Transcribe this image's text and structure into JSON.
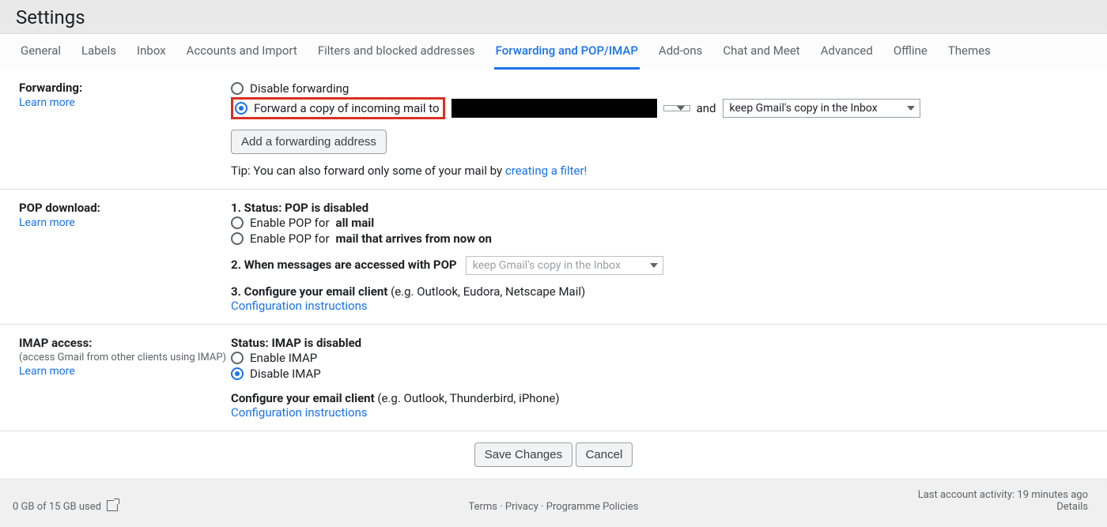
{
  "title": "Settings",
  "tabs": [
    "General",
    "Labels",
    "Inbox",
    "Accounts and Import",
    "Filters and blocked addresses",
    "Forwarding and POP/IMAP",
    "Add-ons",
    "Chat and Meet",
    "Advanced",
    "Offline",
    "Themes"
  ],
  "active_tab_index": 5,
  "forwarding": {
    "heading": "Forwarding:",
    "learn_more": "Learn more",
    "option_disable": "Disable forwarding",
    "option_forward_prefix": "Forward a copy of incoming mail to",
    "and_word": "and",
    "action_select": "keep Gmail's copy in the Inbox",
    "add_address_btn": "Add a forwarding address",
    "tip_prefix": "Tip: You can also forward only some of your mail by ",
    "tip_link": "creating a filter!"
  },
  "pop": {
    "heading": "POP download:",
    "learn_more": "Learn more",
    "status_label": "1. Status: ",
    "status_value": "POP is disabled",
    "enable_all_prefix": "Enable POP for ",
    "enable_all_bold": "all mail",
    "enable_new_prefix": "Enable POP for ",
    "enable_new_bold": "mail that arrives from now on",
    "when_label": "2. When messages are accessed with POP",
    "when_select": "keep Gmail's copy in the Inbox",
    "configure_label": "3. Configure your email client ",
    "configure_hint": "(e.g. Outlook, Eudora, Netscape Mail)",
    "config_link": "Configuration instructions"
  },
  "imap": {
    "heading": "IMAP access:",
    "note": "(access Gmail from other clients using IMAP)",
    "learn_more": "Learn more",
    "status_label": "Status: ",
    "status_value": "IMAP is disabled",
    "enable_label": "Enable IMAP",
    "disable_label": "Disable IMAP",
    "configure_label": "Configure your email client ",
    "configure_hint": "(e.g. Outlook, Thunderbird, iPhone)",
    "config_link": "Configuration instructions"
  },
  "buttons": {
    "save": "Save Changes",
    "cancel": "Cancel"
  },
  "footer": {
    "storage": "0 GB of 15 GB used",
    "links": [
      "Terms",
      "Privacy",
      "Programme Policies"
    ],
    "activity": "Last account activity: 19 minutes ago",
    "details": "Details"
  }
}
